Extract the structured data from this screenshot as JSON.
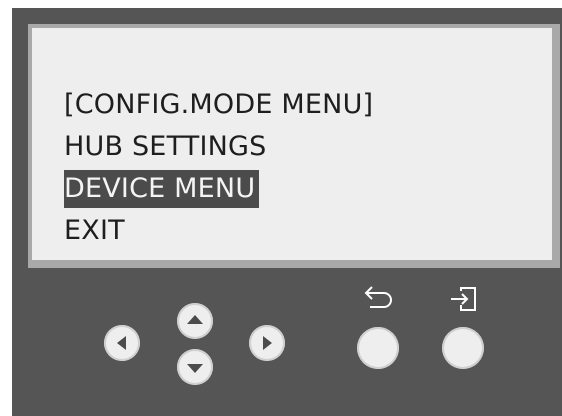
{
  "screen": {
    "lines": [
      {
        "text": "[CONFIG.MODE MENU]",
        "selected": false
      },
      {
        "text": "HUB SETTINGS",
        "selected": false
      },
      {
        "text": "DEVICE MENU",
        "selected": true
      },
      {
        "text": "EXIT",
        "selected": false
      }
    ]
  },
  "controls": {
    "left": {
      "icon": "arrow-left-icon"
    },
    "up": {
      "icon": "arrow-up-icon"
    },
    "down": {
      "icon": "arrow-down-icon"
    },
    "right": {
      "icon": "arrow-right-icon"
    },
    "back": {
      "icon": "return-arrow-icon"
    },
    "enter": {
      "icon": "enter-icon"
    }
  },
  "colors": {
    "housing": "#555555",
    "lcd_background": "#eeeeee",
    "highlight": "#4b4b4b",
    "button": "#eeeeee"
  }
}
